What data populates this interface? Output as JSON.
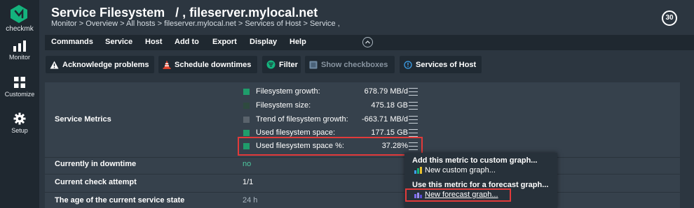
{
  "sidebar": {
    "brand": "checkmk",
    "items": [
      {
        "label": "Monitor",
        "icon": "bar-chart-icon"
      },
      {
        "label": "Customize",
        "icon": "grid-icon"
      },
      {
        "label": "Setup",
        "icon": "gear-icon"
      }
    ]
  },
  "header": {
    "title": "Service Filesystem   / , fileserver.mylocal.net",
    "breadcrumb": "Monitor > Overview > All hosts > fileserver.mylocal.net > Services of Host > Service ,",
    "refresh_seconds": "30"
  },
  "menubar": {
    "items": [
      "Commands",
      "Service",
      "Host",
      "Add to",
      "Export",
      "Display",
      "Help"
    ]
  },
  "toolbar": {
    "acknowledge": "Acknowledge problems",
    "schedule": "Schedule downtimes",
    "filter": "Filter",
    "show_checkboxes": "Show checkboxes",
    "services_of_host": "Services of Host"
  },
  "table": {
    "service_metrics_label": "Service Metrics",
    "metrics": [
      {
        "name": "Filesystem growth:",
        "value": "678.79 MB/d",
        "color": "#1f9d6b"
      },
      {
        "name": "Filesystem size:",
        "value": "475.18 GB",
        "color": "#2e4a3f"
      },
      {
        "name": "Trend of filesystem growth:",
        "value": "-663.71 MB/d",
        "color": "#5a636c"
      },
      {
        "name": "Used filesystem space:",
        "value": "177.15 GB",
        "color": "#1f9d6b"
      },
      {
        "name": "Used filesystem space %:",
        "value": "37.28%",
        "color": "#1f9d6b"
      }
    ],
    "rows": [
      {
        "label": "Currently in downtime",
        "value": "no"
      },
      {
        "label": "Current check attempt",
        "value": "1/1"
      },
      {
        "label": "The age of the current service state",
        "value": "24 h"
      }
    ]
  },
  "popup": {
    "custom_header": "Add this metric to custom graph...",
    "custom_action": "New custom graph...",
    "forecast_header": "Use this metric for a forecast graph...",
    "forecast_action": "New forecast graph..."
  },
  "colors": {
    "background": "#2c3640",
    "sidebar": "#1f2830",
    "accent": "#1f9d6b",
    "highlight": "#e23a3a",
    "ok_text": "#4ec9a0"
  }
}
